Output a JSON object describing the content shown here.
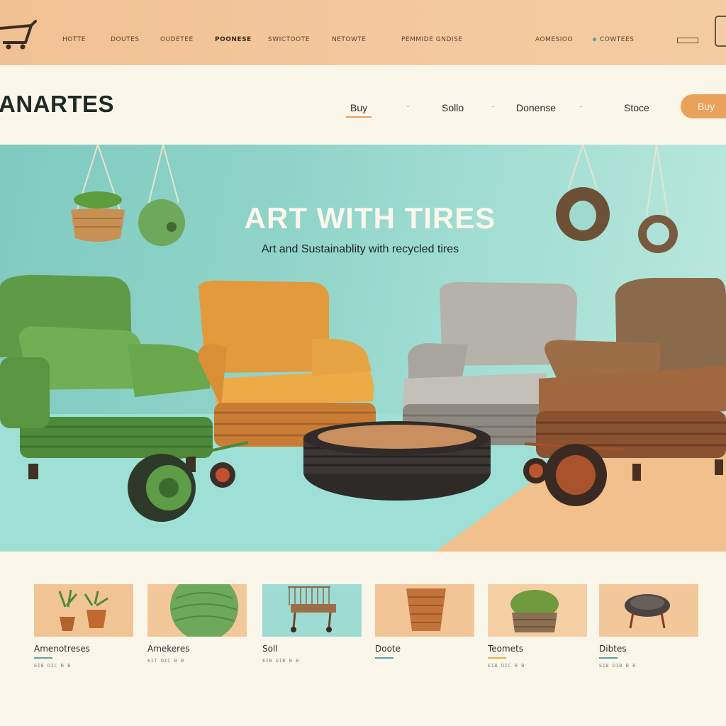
{
  "nav": {
    "links": [
      "HOTTE",
      "DOUTES",
      "OUDETEE",
      "POONESE",
      "SWICTOOTE",
      "NETOWTE",
      "PEMMIDE GNDISE"
    ],
    "right_links": [
      "AOMESIOO",
      "COWTEES"
    ]
  },
  "header": {
    "brand": "ANARTES",
    "links": [
      "Buy",
      "Sollo",
      "Donense",
      "Stoce"
    ],
    "buy_button": "Buy"
  },
  "hero": {
    "title": "ART WITH TIRES",
    "subtitle": "Art and Sustainablity with recycled tires"
  },
  "products": [
    {
      "title": "Amenotreses",
      "meta": "EIB DIC  B  B",
      "bg": "#f1c494"
    },
    {
      "title": "Amekeres",
      "meta": "EIT DIC  B  B",
      "bg": "#f2c79a"
    },
    {
      "title": "Soll",
      "meta": "EIB DIB  B  B",
      "bg": "#9edbd2"
    },
    {
      "title": "Doote",
      "meta": "",
      "bg": "#f2c597"
    },
    {
      "title": "Teomets",
      "meta": "EIB DIC  B  B",
      "bg": "#f4cfa4"
    },
    {
      "title": "Dibtes",
      "meta": "EIB DIB  B  B",
      "bg": "#f2c79a"
    }
  ],
  "colors": {
    "accent": "#e9a15b",
    "teal": "#5ea3a0",
    "hero_teal": "#8fd3c8",
    "topbar": "#f2c69a",
    "page": "#fbf6ea"
  }
}
